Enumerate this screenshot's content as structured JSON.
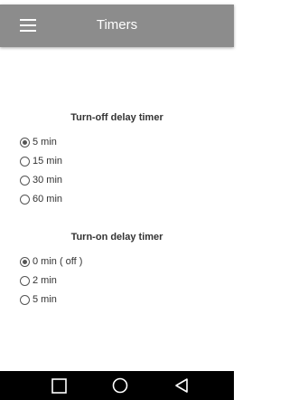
{
  "app_bar": {
    "title": "Timers",
    "menu_icon": "hamburger-menu-icon"
  },
  "turn_off": {
    "title": "Turn-off delay timer",
    "selected": 0,
    "options": [
      {
        "label": "5 min"
      },
      {
        "label": "15 min"
      },
      {
        "label": "30 min"
      },
      {
        "label": "60 min"
      }
    ]
  },
  "turn_on": {
    "title": "Turn-on delay timer",
    "selected": 0,
    "options": [
      {
        "label": "0 min ( off )"
      },
      {
        "label": "2 min"
      },
      {
        "label": "5 min"
      }
    ]
  },
  "nav_bar": {
    "icons": [
      "recents-square-icon",
      "home-circle-icon",
      "back-triangle-icon"
    ]
  },
  "colors": {
    "app_bar": "#8c8c8c",
    "nav_bar": "#000000",
    "text": "#333333"
  }
}
